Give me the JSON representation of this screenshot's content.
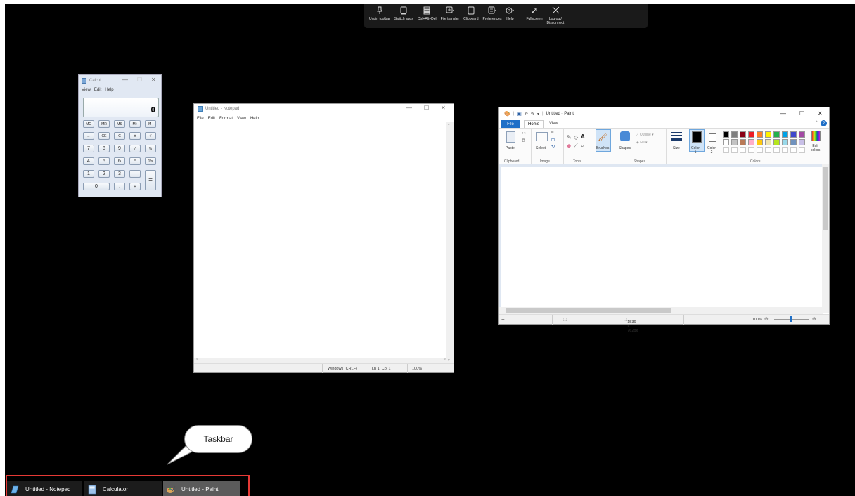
{
  "remote_toolbar": {
    "items": [
      {
        "label": "Unpin toolbar",
        "icon": "pin-icon"
      },
      {
        "label": "Switch apps",
        "icon": "switch-apps-icon"
      },
      {
        "label": "Ctrl+Alt+Del",
        "icon": "ctrl-alt-del-icon"
      },
      {
        "label": "File transfer",
        "icon": "file-transfer-icon"
      },
      {
        "label": "Clipboard",
        "icon": "clipboard-icon"
      },
      {
        "label": "Preferences",
        "icon": "preferences-icon"
      },
      {
        "label": "Help",
        "icon": "help-icon"
      },
      {
        "label": "Fullscreen",
        "icon": "fullscreen-icon"
      },
      {
        "label": "Log out/",
        "label2": "Disconnect",
        "icon": "close-icon"
      }
    ]
  },
  "calculator": {
    "title": "Calcul...",
    "menu": [
      "View",
      "Edit",
      "Help"
    ],
    "display": "0",
    "rows": [
      [
        "MC",
        "MR",
        "MS",
        "M+",
        "M-"
      ],
      [
        "←",
        "CE",
        "C",
        "±",
        "√"
      ],
      [
        "7",
        "8",
        "9",
        "/",
        "%"
      ],
      [
        "4",
        "5",
        "6",
        "*",
        "1/x"
      ],
      [
        "1",
        "2",
        "3",
        "-",
        "="
      ],
      [
        "0",
        ".",
        "+"
      ]
    ]
  },
  "notepad": {
    "title": "Untitled - Notepad",
    "menu": [
      "File",
      "Edit",
      "Format",
      "View",
      "Help"
    ],
    "status": {
      "line_ending": "Windows (CRLF)",
      "position": "Ln 1, Col 1",
      "zoom": "100%"
    }
  },
  "paint": {
    "title": "Untitled - Paint",
    "tabs": {
      "file": "File",
      "home": "Home",
      "view": "View"
    },
    "tools": {
      "paste": "Paste",
      "select": "Select",
      "brushes": "Brushes",
      "shapes": "Shapes",
      "outline": "Outline",
      "fill": "Fill",
      "size": "Size",
      "color1": "Color",
      "color1_num": "1",
      "color2": "Color",
      "color2_num": "2",
      "edit_colors": "Edit",
      "edit_colors2": "colors"
    },
    "groups": [
      "Clipboard",
      "Image",
      "Tools",
      "Shapes",
      "Colors"
    ],
    "palette_row1": [
      "#000000",
      "#7f7f7f",
      "#880015",
      "#ed1c24",
      "#ff7f27",
      "#fff200",
      "#22b14c",
      "#00a2e8",
      "#3f48cc",
      "#a349a4"
    ],
    "palette_row2": [
      "#ffffff",
      "#c3c3c3",
      "#b97a57",
      "#ffaec9",
      "#ffc90e",
      "#efe4b0",
      "#b5e61d",
      "#99d9ea",
      "#7092be",
      "#c8bfe7"
    ],
    "status": {
      "dimensions": "1536 × 762px",
      "zoom": "100%"
    }
  },
  "callout": {
    "text": "Taskbar"
  },
  "taskbar": {
    "items": [
      {
        "label": "Untitled - Notepad"
      },
      {
        "label": "Calculator"
      },
      {
        "label": "Untitled - Paint"
      }
    ]
  }
}
